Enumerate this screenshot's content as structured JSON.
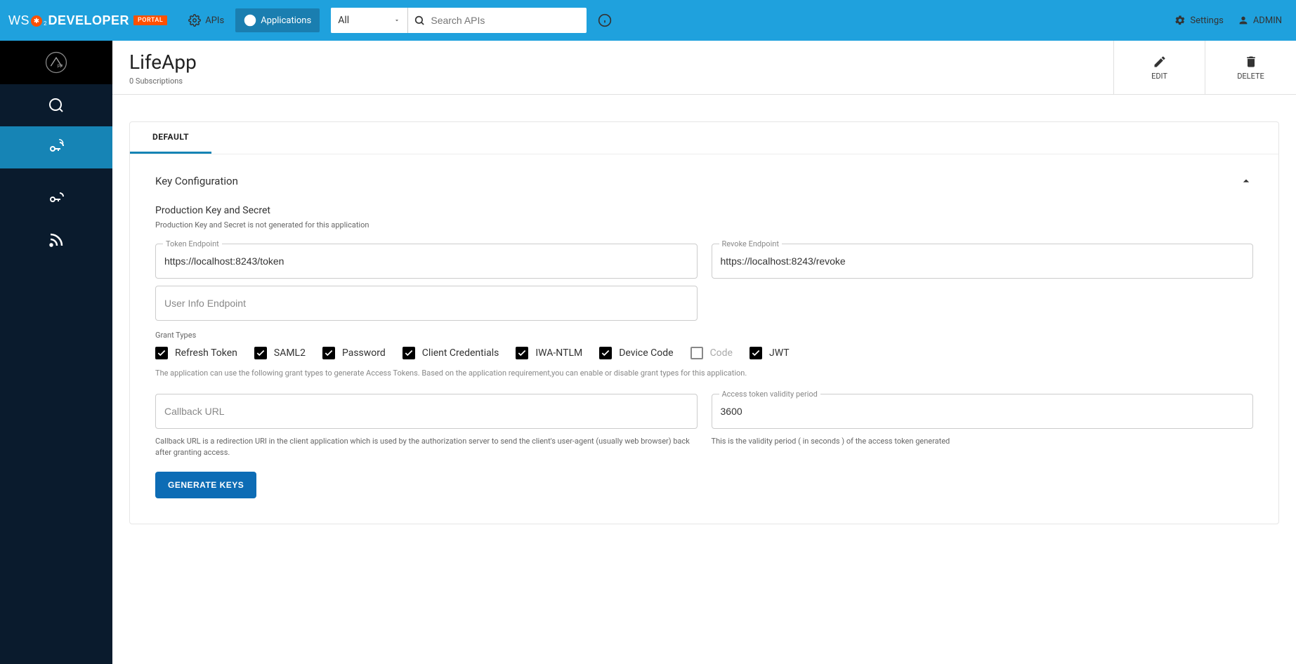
{
  "header": {
    "logo_ws": "WS",
    "logo_dev": "DEVELOPER",
    "logo_portal": "PORTAL",
    "nav_apis": "APIs",
    "nav_applications": "Applications",
    "search_dropdown": "All",
    "search_placeholder": "Search APIs",
    "settings": "Settings",
    "user": "ADMIN"
  },
  "page": {
    "title": "LifeApp",
    "subscriptions": "0 Subscriptions",
    "edit": "EDIT",
    "delete": "DELETE"
  },
  "tabs": {
    "default": "DEFAULT"
  },
  "keyconfig": {
    "heading": "Key Configuration",
    "prod_title": "Production Key and Secret",
    "prod_desc": "Production Key and Secret is not generated for this application",
    "token_label": "Token Endpoint",
    "token_value": "https://localhost:8243/token",
    "revoke_label": "Revoke Endpoint",
    "revoke_value": "https://localhost:8243/revoke",
    "userinfo_placeholder": "User Info Endpoint",
    "grant_label": "Grant Types",
    "grants": {
      "refresh": "Refresh Token",
      "saml2": "SAML2",
      "password": "Password",
      "client_cred": "Client Credentials",
      "iwa": "IWA-NTLM",
      "device": "Device Code",
      "code": "Code",
      "jwt": "JWT"
    },
    "grant_helper": "The application can use the following grant types to generate Access Tokens. Based on the application requirement,you can enable or disable grant types for this application.",
    "callback_label": "Callback URL",
    "callback_helper": "Callback URL is a redirection URI in the client application which is used by the authorization server to send the client's user-agent (usually web browser) back after granting access.",
    "validity_label": "Access token validity period",
    "validity_value": "3600",
    "validity_helper": "This is the validity period ( in seconds ) of the access token generated",
    "generate_btn": "GENERATE KEYS"
  }
}
